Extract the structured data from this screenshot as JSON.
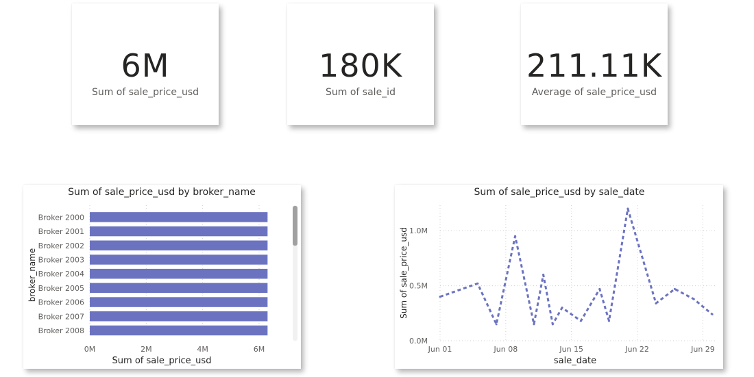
{
  "kpis": [
    {
      "value": "6M",
      "label": "Sum of sale_price_usd"
    },
    {
      "value": "180K",
      "label": "Sum of sale_id"
    },
    {
      "value": "211.11K",
      "label": "Average of sale_price_usd"
    }
  ],
  "colors": {
    "accent": "#6b73c1",
    "grid": "#d0d0d0",
    "shadow": "#bbbbbb"
  },
  "chart_data": [
    {
      "type": "bar",
      "orientation": "horizontal",
      "title": "Sum of sale_price_usd by broker_name",
      "xlabel": "Sum of sale_price_usd",
      "ylabel": "broker_name",
      "categories": [
        "Broker 2000",
        "Broker 2001",
        "Broker 2002",
        "Broker 2003",
        "Broker 2004",
        "Broker 2005",
        "Broker 2006",
        "Broker 2007",
        "Broker 2008"
      ],
      "values": [
        6300000,
        6300000,
        6300000,
        6300000,
        6300000,
        6300000,
        6300000,
        6300000,
        6300000
      ],
      "xticks": [
        "0M",
        "2M",
        "4M",
        "6M"
      ],
      "xlim": [
        0,
        6000000
      ],
      "grid": true,
      "scrollbar": true
    },
    {
      "type": "line",
      "title": "Sum of sale_price_usd by sale_date",
      "xlabel": "sale_date",
      "ylabel": "Sum of sale_price_usd",
      "line_style": "dashed",
      "x": [
        "Jun 01",
        "Jun 05",
        "Jun 07",
        "Jun 09",
        "Jun 11",
        "Jun 12",
        "Jun 13",
        "Jun 14",
        "Jun 16",
        "Jun 18",
        "Jun 19",
        "Jun 21",
        "Jun 24",
        "Jun 26",
        "Jun 28",
        "Jun 30"
      ],
      "y": [
        400000,
        520000,
        150000,
        950000,
        150000,
        600000,
        150000,
        300000,
        180000,
        470000,
        180000,
        1200000,
        340000,
        470000,
        380000,
        240000
      ],
      "xticks": [
        "Jun 01",
        "Jun 08",
        "Jun 15",
        "Jun 22",
        "Jun 29"
      ],
      "yticks": [
        "0.0M",
        "0.5M",
        "1.0M"
      ],
      "ylim": [
        0,
        1200000
      ],
      "grid": true
    }
  ]
}
